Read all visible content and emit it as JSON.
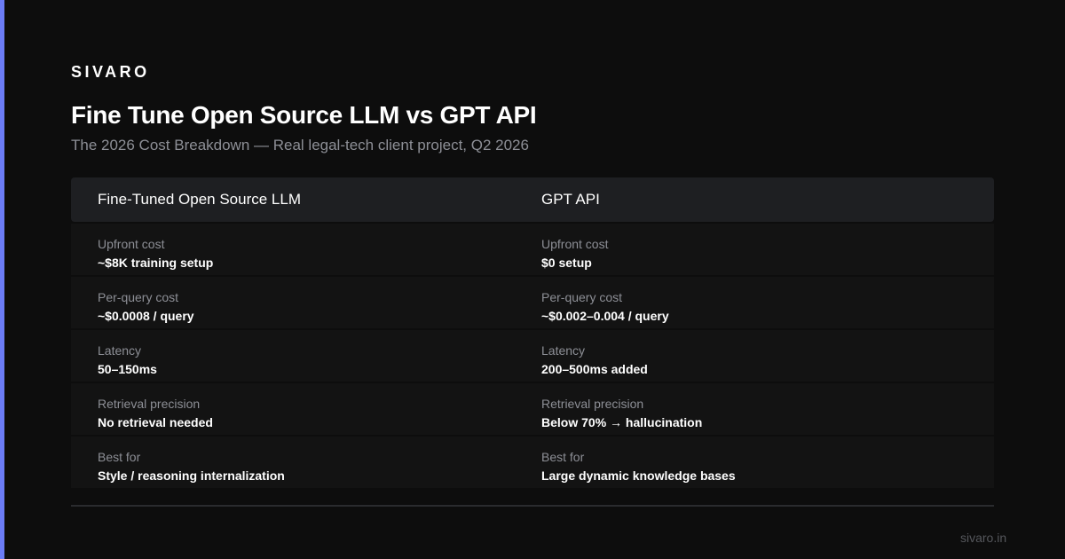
{
  "brand": "SIVARO",
  "title": "Fine Tune Open Source LLM vs GPT API",
  "subtitle": "The 2026 Cost Breakdown — Real legal-tech client project, Q2 2026",
  "columns": [
    {
      "header": "Fine-Tuned Open Source LLM",
      "rows": [
        {
          "label": "Upfront cost",
          "value": "~$8K training setup"
        },
        {
          "label": "Per-query cost",
          "value": "~$0.0008 / query"
        },
        {
          "label": "Latency",
          "value": "50–150ms"
        },
        {
          "label": "Retrieval precision",
          "value": "No retrieval needed"
        },
        {
          "label": "Best for",
          "value": "Style / reasoning internalization"
        }
      ]
    },
    {
      "header": "GPT API",
      "rows": [
        {
          "label": "Upfront cost",
          "value": "$0 setup"
        },
        {
          "label": "Per-query cost",
          "value": "~$0.002–0.004 / query"
        },
        {
          "label": "Latency",
          "value": "200–500ms added"
        },
        {
          "label": "Retrieval precision",
          "value": "Below 70% → hallucination"
        },
        {
          "label": "Best for",
          "value": "Large dynamic knowledge bases"
        }
      ]
    }
  ],
  "footer": "sivaro.in",
  "colors": {
    "accent": "#6b7cf6",
    "background": "#0d0d0d",
    "header_bg": "#1e1f22",
    "row_bg": "#131313"
  }
}
